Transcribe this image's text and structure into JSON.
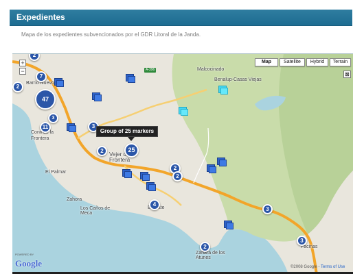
{
  "page": {
    "title": "Expedientes",
    "subtitle": "Mapa de los expedientes subvencionados por el GDR Litoral de la Janda."
  },
  "map": {
    "map_types": [
      "Map",
      "Satellite",
      "Hybrid",
      "Terrain"
    ],
    "selected_map_type": "Map",
    "zoom_in": "+",
    "zoom_out": "−",
    "fullscreen": "⊠",
    "tooltip": "Group of 25 markers",
    "places": [
      {
        "name": "Barrio Nuevo"
      },
      {
        "name": "Malcocinado"
      },
      {
        "name": "Benalup-Casas Viejas"
      },
      {
        "name": "Conil de la Frontera"
      },
      {
        "name": "Vejer de la Frontera"
      },
      {
        "name": "El Palmar"
      },
      {
        "name": "Zahora"
      },
      {
        "name": "Los Caños de Meca"
      },
      {
        "name": "Barbate"
      },
      {
        "name": "Zahara de los Atunes"
      },
      {
        "name": "Facinas"
      }
    ],
    "road_badge": "A-396",
    "clusters": [
      {
        "count": "2"
      },
      {
        "count": "7"
      },
      {
        "count": "2"
      },
      {
        "count": "47"
      },
      {
        "count": "3"
      },
      {
        "count": "11"
      },
      {
        "count": "3"
      },
      {
        "count": "2"
      },
      {
        "count": "25"
      },
      {
        "count": "2"
      },
      {
        "count": "2"
      },
      {
        "count": "4"
      },
      {
        "count": "3"
      },
      {
        "count": "2"
      },
      {
        "count": "3"
      }
    ],
    "google_logo": "Google",
    "powered_by": "POWERED BY",
    "copyright": "©2008 Google -",
    "terms": "Terms of Use",
    "colors": {
      "sea": "#aad3df",
      "land": "#e9e6dd",
      "terrain": "#c9dcaa",
      "road": "#f2a52a",
      "cluster": "#2b56a8",
      "header": "#1d6c91"
    }
  }
}
